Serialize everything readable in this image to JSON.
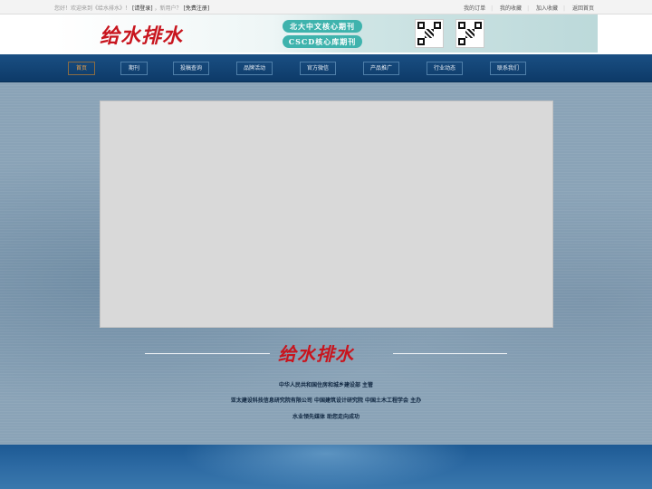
{
  "topbar": {
    "greeting": "您好！欢迎来到《给水排水》！",
    "login": "[请登录]",
    "new_user": "，新用户？",
    "register": "[免费注册]",
    "links": [
      "我的订单",
      "我的收藏",
      "加入收藏",
      "返回首页"
    ]
  },
  "header": {
    "logo": "给水排水",
    "badges": [
      "北大中文核心期刊",
      "CSCD核心库期刊"
    ]
  },
  "nav": {
    "items": [
      "首页",
      "期刊",
      "投稿查询",
      "品牌活动",
      "官方微信",
      "产品推广",
      "行业动态",
      "联系我们"
    ]
  },
  "main": {
    "logo": "给水排水",
    "org_lines": [
      "中华人民共和国住房和城乡建设部 主管",
      "亚太建设科技信息研究院有限公司 中国建筑设计研究院 中国土木工程学会 主办",
      "水业领先媒体 助您走向成功"
    ]
  }
}
